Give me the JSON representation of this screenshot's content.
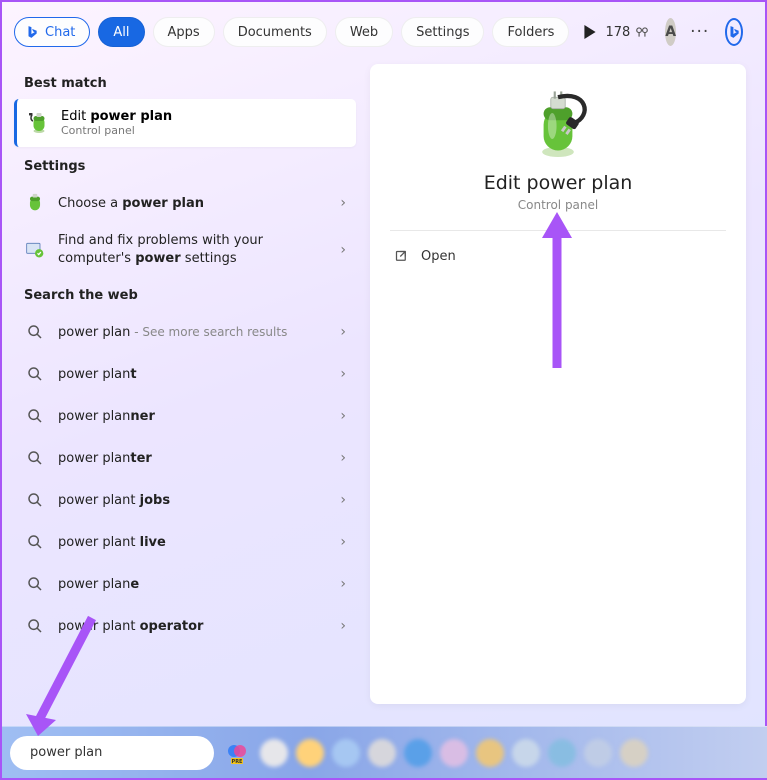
{
  "colors": {
    "accent": "#1868e3",
    "annotation": "#a855f7"
  },
  "topbar": {
    "chat": "Chat",
    "tabs": [
      "All",
      "Apps",
      "Documents",
      "Web",
      "Settings",
      "Folders"
    ],
    "points": "178",
    "avatar_letter": "A"
  },
  "sections": {
    "best_match": "Best match",
    "settings": "Settings",
    "search_web": "Search the web"
  },
  "best": {
    "title_pre": "Edit ",
    "title_bold": "power plan",
    "subtitle": "Control panel"
  },
  "settings_items": [
    {
      "pre": "Choose a ",
      "bold": "power plan",
      "post": "",
      "icon": "pp"
    },
    {
      "pre": "Find and fix problems with your computer's ",
      "bold": "power",
      "post": " settings",
      "icon": "trouble"
    }
  ],
  "web_items": [
    {
      "pre": "power plan",
      "bold": "",
      "post": "",
      "extra": " - See more search results"
    },
    {
      "pre": "power plan",
      "bold": "t",
      "post": ""
    },
    {
      "pre": "power plan",
      "bold": "ner",
      "post": ""
    },
    {
      "pre": "power plan",
      "bold": "ter",
      "post": ""
    },
    {
      "pre": "power plant ",
      "bold": "jobs",
      "post": ""
    },
    {
      "pre": "power plant ",
      "bold": "live",
      "post": ""
    },
    {
      "pre": "power plan",
      "bold": "e",
      "post": ""
    },
    {
      "pre": "power plant ",
      "bold": "operator",
      "post": ""
    }
  ],
  "detail": {
    "title": "Edit power plan",
    "subtitle": "Control panel",
    "open_label": "Open"
  },
  "search": {
    "value": "power plan"
  }
}
